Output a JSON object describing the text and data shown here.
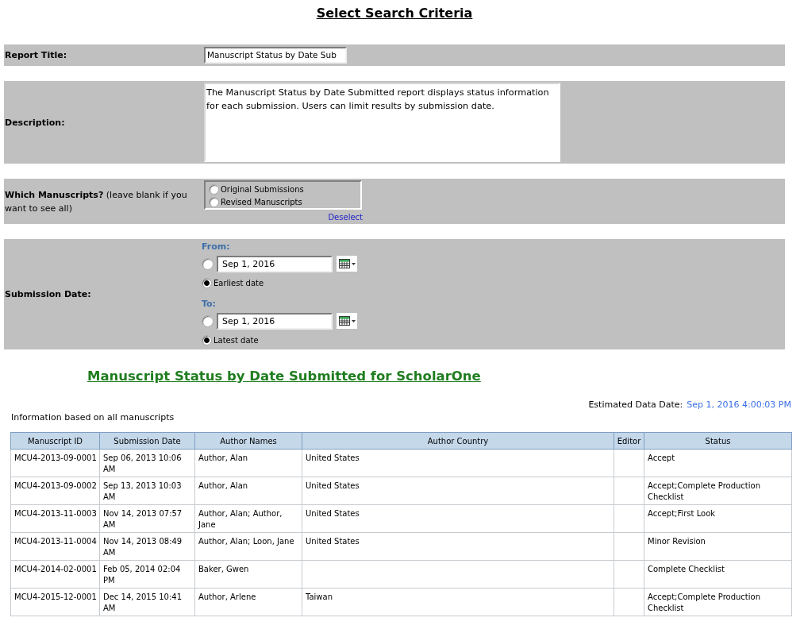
{
  "page_title": "Select Search Criteria",
  "criteria": [
    {
      "kind": "text",
      "label": "Report Title:",
      "value": "Manuscript Status by Date Sub"
    },
    {
      "kind": "textarea",
      "label": "Description:",
      "value": "The Manuscript Status by Date Submitted report displays status information for each submission. Users can limit results by submission date."
    },
    {
      "kind": "choice",
      "label": "Which Manuscripts?",
      "hint": "(leave blank if you want to see all)",
      "options": [
        {
          "label": "Original Submissions",
          "selected": false
        },
        {
          "label": "Revised Manuscripts",
          "selected": false
        }
      ],
      "link": "Deselect"
    },
    {
      "kind": "date_range",
      "label": "Submission Date:",
      "ranges": [
        {
          "heading": "From:",
          "options": [
            {
              "kind": "date",
              "value": "Sep 1, 2016",
              "selected": false
            },
            {
              "kind": "preset",
              "label": "Earliest date",
              "selected": true
            }
          ]
        },
        {
          "heading": "To:",
          "options": [
            {
              "kind": "date",
              "value": "Sep 1, 2016",
              "selected": false
            },
            {
              "kind": "preset",
              "label": "Latest date",
              "selected": true
            }
          ]
        }
      ]
    }
  ],
  "report": {
    "title": "Manuscript Status by Date Submitted for ScholarOne",
    "data_date_label": "Estimated Data Date:",
    "data_date": "Sep 1, 2016 4:00:03 PM",
    "note": "Information based on all manuscripts",
    "table": {
      "columns": [
        "Manuscript ID",
        "Submission Date",
        "Author Names",
        "Author Country",
        "Editor",
        "Status"
      ],
      "rows": [
        [
          "MCU4-2013-09-0001",
          "Sep 06, 2013 10:06 AM",
          "Author, Alan",
          "United States",
          null,
          "Accept"
        ],
        [
          "MCU4-2013-09-0002",
          "Sep 13, 2013 10:03 AM",
          "Author, Alan",
          "United States",
          null,
          "Accept;Complete Production Checklist"
        ],
        [
          "MCU4-2013-11-0003",
          "Nov 14, 2013 07:57 AM",
          "Author, Alan; Author, Jane",
          "United States",
          null,
          "Accept;First Look"
        ],
        [
          "MCU4-2013-11-0004",
          "Nov 14, 2013 08:49 AM",
          "Author, Alan; Loon, Jane",
          "United States",
          null,
          "Minor Revision"
        ],
        [
          "MCU4-2014-02-0001",
          "Feb 05, 2014 02:04 PM",
          "Baker, Gwen",
          null,
          null,
          "Complete Checklist"
        ],
        [
          "MCU4-2015-12-0001",
          "Dec 14, 2015 10:41 AM",
          "Author, Arlene",
          "Taiwan",
          null,
          "Accept;Complete Production Checklist"
        ]
      ]
    }
  }
}
